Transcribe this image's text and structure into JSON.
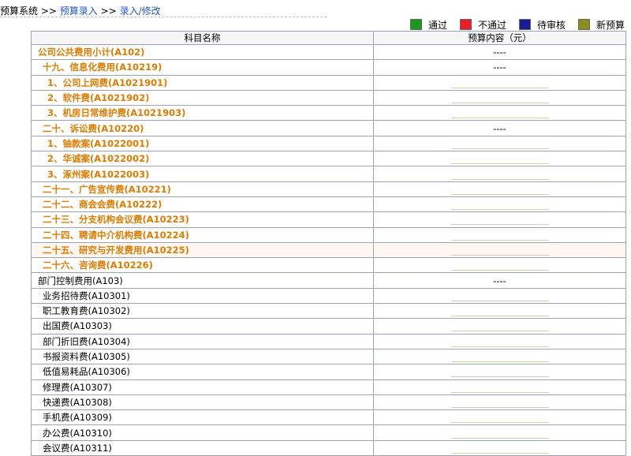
{
  "breadcrumb": {
    "root": "预算系统",
    "sep1": ">>",
    "link1": "预算录入",
    "sep2": ">>",
    "link2": "录入/修改"
  },
  "legend": [
    {
      "label": "通过",
      "color": "#1a9a1a"
    },
    {
      "label": "不通过",
      "color": "#ee1c24"
    },
    {
      "label": "待审核",
      "color": "#1a1a99"
    },
    {
      "label": "新预算",
      "color": "#8c8c1a"
    }
  ],
  "table": {
    "headers": {
      "name": "科目名称",
      "value": "预算内容（元）"
    },
    "rows": [
      {
        "label": "公司公共费用小计(A102)",
        "value": "----",
        "style": "orange",
        "indent": 0,
        "editable": false
      },
      {
        "label": "十九、信息化费用(A10219)",
        "value": "----",
        "style": "orange",
        "indent": 1,
        "editable": false
      },
      {
        "label": "1、公司上网费(A1021901)",
        "value": "",
        "style": "orange",
        "indent": 2,
        "editable": true
      },
      {
        "label": "2、软件费(A1021902)",
        "value": "",
        "style": "orange",
        "indent": 2,
        "editable": true
      },
      {
        "label": "3、机房日常维护费(A1021903)",
        "value": "",
        "style": "orange",
        "indent": 2,
        "editable": true
      },
      {
        "label": "二十、诉讼费(A10220)",
        "value": "----",
        "style": "orange",
        "indent": 1,
        "editable": false
      },
      {
        "label": "1、铀款案(A1022001)",
        "value": "",
        "style": "orange",
        "indent": 2,
        "editable": true
      },
      {
        "label": "2、华诚案(A1022002)",
        "value": "",
        "style": "orange",
        "indent": 2,
        "editable": true
      },
      {
        "label": "3、涿州案(A1022003)",
        "value": "",
        "style": "orange",
        "indent": 2,
        "editable": true
      },
      {
        "label": "二十一、广告宣传费(A10221)",
        "value": "",
        "style": "orange",
        "indent": 1,
        "editable": true
      },
      {
        "label": "二十二、商会会费(A10222)",
        "value": "",
        "style": "orange",
        "indent": 1,
        "editable": true
      },
      {
        "label": "二十三、分支机构会议费(A10223)",
        "value": "",
        "style": "orange",
        "indent": 1,
        "editable": true
      },
      {
        "label": "二十四、聘请中介机构费(A10224)",
        "value": "",
        "style": "orange",
        "indent": 1,
        "editable": true
      },
      {
        "label": "二十五、研究与开发费用(A10225)",
        "value": "",
        "style": "orange",
        "indent": 1,
        "editable": true,
        "highlight": true
      },
      {
        "label": "二十六、咨询费(A10226)",
        "value": "",
        "style": "orange",
        "indent": 1,
        "editable": true
      },
      {
        "label": "部门控制费用(A103)",
        "value": "----",
        "style": "black",
        "indent": 0,
        "editable": false
      },
      {
        "label": "业务招待费(A10301)",
        "value": "",
        "style": "black",
        "indent": 1,
        "editable": true
      },
      {
        "label": "职工教育费(A10302)",
        "value": "",
        "style": "black",
        "indent": 1,
        "editable": true
      },
      {
        "label": "出国费(A10303)",
        "value": "",
        "style": "black",
        "indent": 1,
        "editable": true
      },
      {
        "label": "部门折旧费(A10304)",
        "value": "",
        "style": "black",
        "indent": 1,
        "editable": true
      },
      {
        "label": "书报资料费(A10305)",
        "value": "",
        "style": "black",
        "indent": 1,
        "editable": true
      },
      {
        "label": "低值易耗品(A10306)",
        "value": "",
        "style": "black",
        "indent": 1,
        "editable": true
      },
      {
        "label": "修理费(A10307)",
        "value": "",
        "style": "black",
        "indent": 1,
        "editable": true
      },
      {
        "label": "快递费(A10308)",
        "value": "",
        "style": "black",
        "indent": 1,
        "editable": true
      },
      {
        "label": "手机费(A10309)",
        "value": "",
        "style": "black",
        "indent": 1,
        "editable": true
      },
      {
        "label": "办公费(A10310)",
        "value": "",
        "style": "black",
        "indent": 1,
        "editable": true
      },
      {
        "label": "会议费(A10311)",
        "value": "",
        "style": "black",
        "indent": 1,
        "editable": true
      }
    ]
  }
}
